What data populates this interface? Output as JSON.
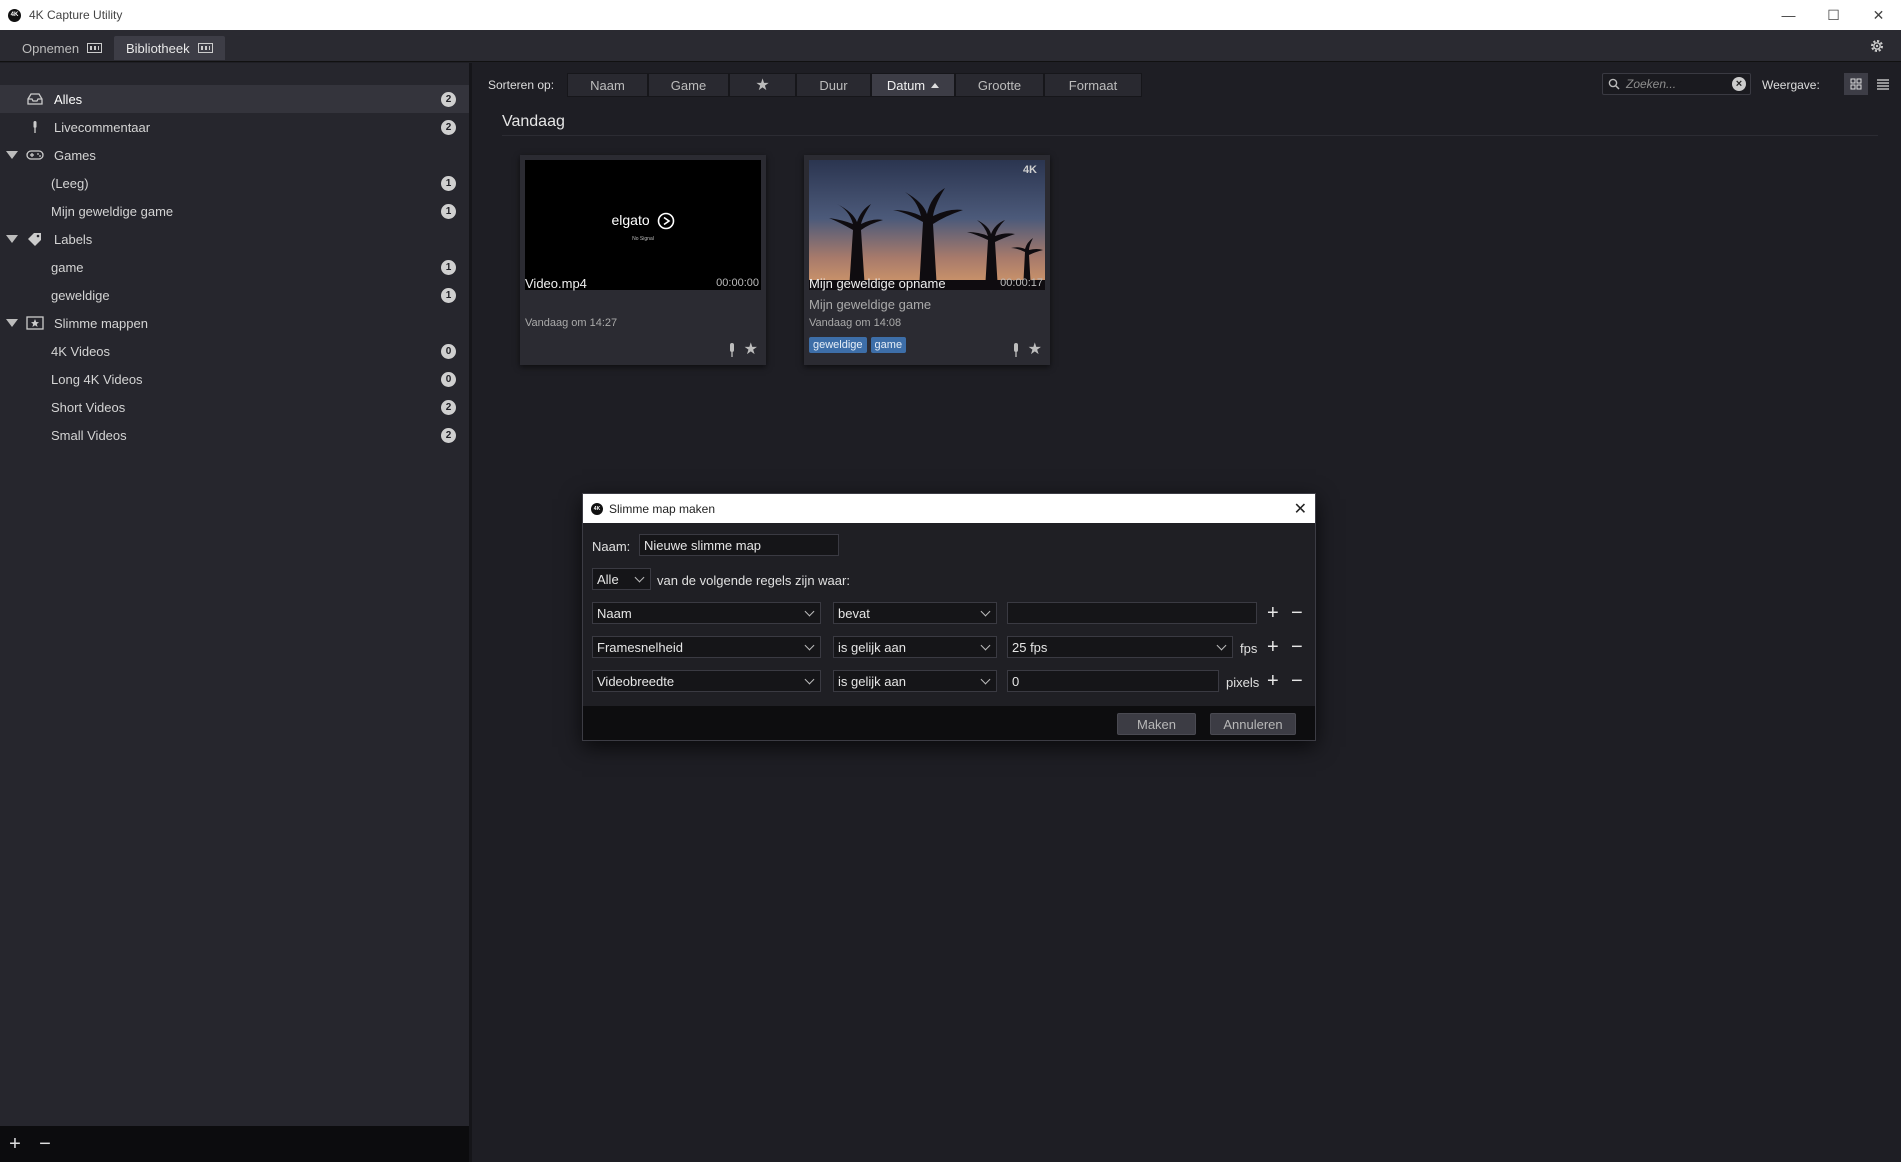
{
  "window": {
    "title": "4K Capture Utility",
    "app_icon": "4K"
  },
  "tabs": [
    {
      "label": "Opnemen"
    },
    {
      "label": "Bibliotheek"
    }
  ],
  "sidebar": {
    "items": [
      {
        "label": "Alles",
        "count": "2"
      },
      {
        "label": "Livecommentaar",
        "count": "2"
      },
      {
        "label": "Games"
      },
      {
        "label": "(Leeg)",
        "count": "1"
      },
      {
        "label": "Mijn geweldige game",
        "count": "1"
      },
      {
        "label": "Labels"
      },
      {
        "label": "game",
        "count": "1"
      },
      {
        "label": "geweldige",
        "count": "1"
      },
      {
        "label": "Slimme mappen"
      },
      {
        "label": "4K Videos",
        "count": "0"
      },
      {
        "label": "Long 4K Videos",
        "count": "0"
      },
      {
        "label": "Short Videos",
        "count": "2"
      },
      {
        "label": "Small Videos",
        "count": "2"
      }
    ],
    "footer": {
      "add": "+",
      "remove": "−"
    }
  },
  "sortbar": {
    "label": "Sorteren op:",
    "buttons": [
      "Naam",
      "Game",
      "★",
      "Duur",
      "Datum",
      "Grootte",
      "Formaat"
    ],
    "active": "Datum",
    "search_placeholder": "Zoeken...",
    "view_label": "Weergave:"
  },
  "section": {
    "title": "Vandaag"
  },
  "cards": [
    {
      "name": "Video.mp4",
      "duration": "00:00:00",
      "game": "",
      "date": "Vandaag om 14:27",
      "tags": [],
      "thumb_text": "elgato",
      "thumb_sub": "No Signal"
    },
    {
      "name": "Mijn geweldige opname",
      "duration": "00:00:17",
      "game": "Mijn geweldige game",
      "date": "Vandaag om 14:08",
      "tags": [
        "geweldige",
        "game"
      ],
      "thumb_badge": "4K"
    }
  ],
  "dialog": {
    "title": "Slimme map maken",
    "name_label": "Naam:",
    "name_value": "Nieuwe slimme map",
    "match_select": "Alle",
    "match_text": "van de volgende regels zijn waar:",
    "rules": [
      {
        "field": "Naam",
        "operator": "bevat",
        "value": "",
        "unit": ""
      },
      {
        "field": "Framesnelheid",
        "operator": "is gelijk aan",
        "value": "25 fps",
        "unit": "fps"
      },
      {
        "field": "Videobreedte",
        "operator": "is gelijk aan",
        "value": "0",
        "unit": "pixels"
      }
    ],
    "plus": "+",
    "minus": "−",
    "create_button": "Maken",
    "cancel_button": "Annuleren"
  },
  "colors": {
    "tag": "#3d6ea8",
    "background": "#1e1e24",
    "sidebar": "#26262d"
  }
}
